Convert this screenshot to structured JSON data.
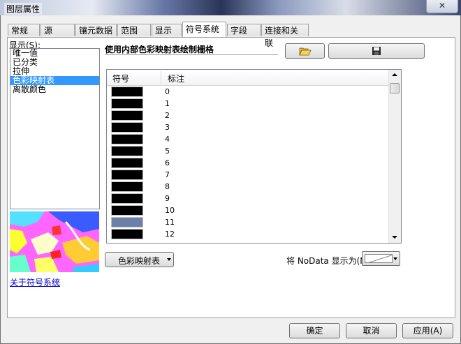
{
  "window": {
    "title": "图层属性",
    "close_label": "✕"
  },
  "tabs": [
    {
      "label": "常规",
      "active": false
    },
    {
      "label": "源",
      "active": false
    },
    {
      "label": "镶元数据",
      "active": false
    },
    {
      "label": "范围",
      "active": false
    },
    {
      "label": "显示",
      "active": false
    },
    {
      "label": "符号系统",
      "active": true
    },
    {
      "label": "字段",
      "active": false
    },
    {
      "label": "连接和关联",
      "active": false
    }
  ],
  "show_label": "显示(S):",
  "renderers": [
    {
      "label": "唯一值",
      "selected": false
    },
    {
      "label": "已分类",
      "selected": false
    },
    {
      "label": "拉伸",
      "selected": false
    },
    {
      "label": "色彩映射表",
      "selected": true
    },
    {
      "label": "离散颜色",
      "selected": false
    }
  ],
  "about_link": "关于符号系统",
  "heading": "使用内部色彩映射表绘制栅格",
  "toolbar": {
    "open_icon": "folder-open-icon",
    "save_icon": "save-disk-icon"
  },
  "table": {
    "col_symbol": "符号",
    "col_label": "标注",
    "rows": [
      {
        "label": "0",
        "color": "#000000"
      },
      {
        "label": "1",
        "color": "#000000"
      },
      {
        "label": "2",
        "color": "#000000"
      },
      {
        "label": "3",
        "color": "#000000"
      },
      {
        "label": "4",
        "color": "#000000"
      },
      {
        "label": "5",
        "color": "#000000"
      },
      {
        "label": "6",
        "color": "#000000"
      },
      {
        "label": "7",
        "color": "#000000"
      },
      {
        "label": "8",
        "color": "#000000"
      },
      {
        "label": "9",
        "color": "#000000"
      },
      {
        "label": "10",
        "color": "#000000"
      },
      {
        "label": "11",
        "color": "#6b7fa8"
      },
      {
        "label": "12",
        "color": "#000000"
      }
    ]
  },
  "colormap_dropdown": "色彩映射表",
  "nodata_label": "将 NoData 显示为(N)",
  "buttons": {
    "ok": "确定",
    "cancel": "取消",
    "apply": "应用(A)"
  }
}
